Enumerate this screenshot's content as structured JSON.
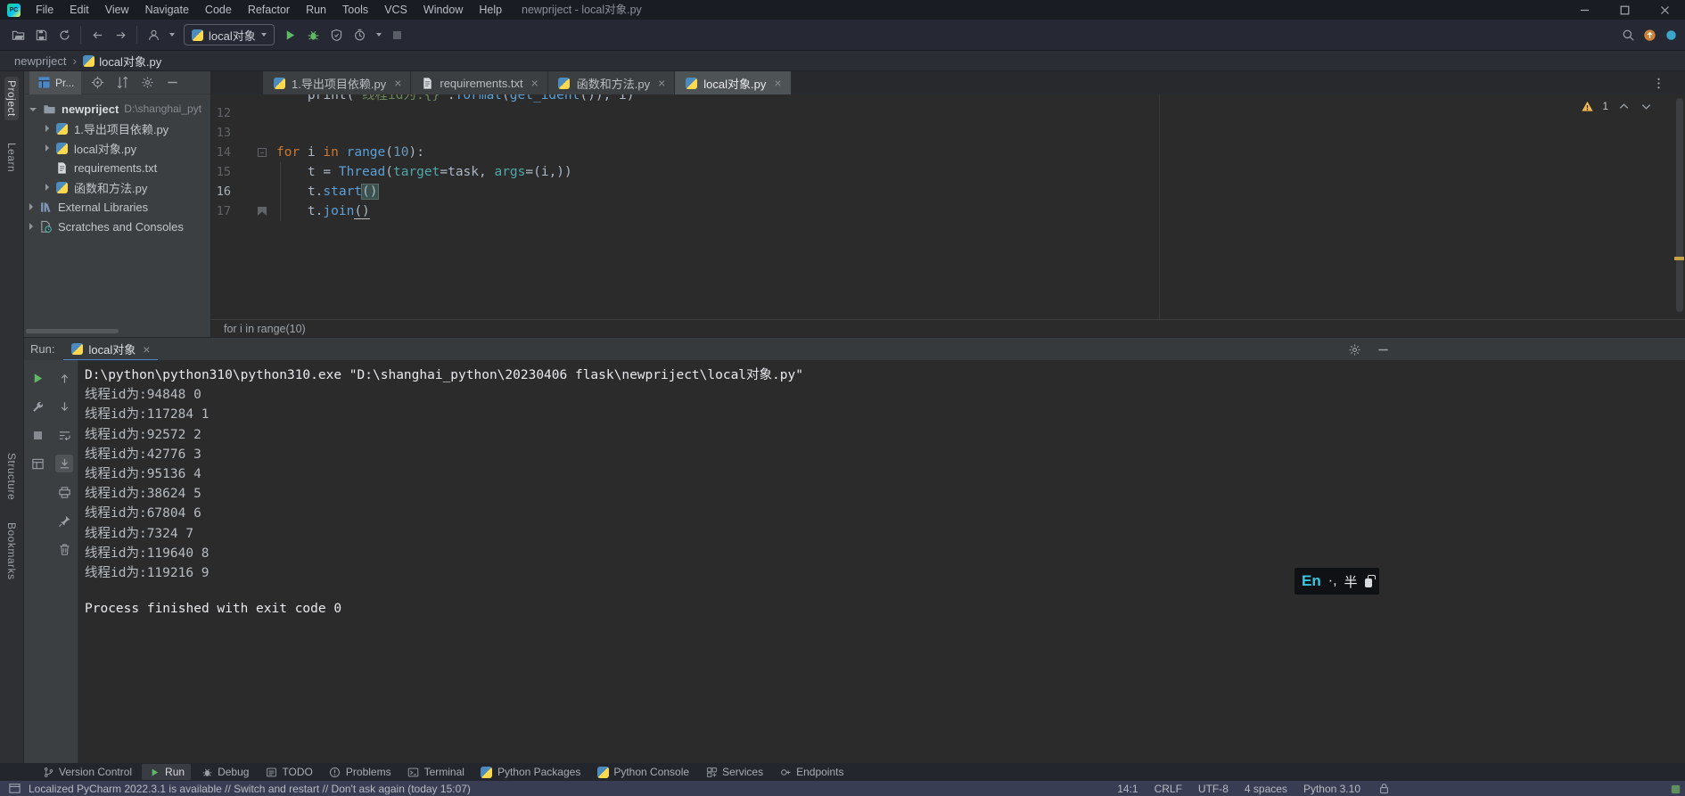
{
  "window": {
    "title": "newpriject - local对象.py"
  },
  "menubar": [
    "File",
    "Edit",
    "View",
    "Navigate",
    "Code",
    "Refactor",
    "Run",
    "Tools",
    "VCS",
    "Window",
    "Help"
  ],
  "toolbar": {
    "run_config_label": "local对象"
  },
  "breadcrumb_bar": [
    "newpriject",
    "local对象.py"
  ],
  "left_stripe": {
    "top": [
      "Project",
      "Learn"
    ],
    "bottom": [
      "Structure",
      "Bookmarks"
    ]
  },
  "project_panel": {
    "tab_label": "Pr...",
    "tree": [
      {
        "depth": 0,
        "chevron": "down",
        "icon": "folder",
        "label": "newpriject",
        "bold": true,
        "path": "D:\\shanghai_pyt"
      },
      {
        "depth": 1,
        "chevron": "right",
        "icon": "python",
        "label": "1.导出项目依赖.py"
      },
      {
        "depth": 1,
        "chevron": "right",
        "icon": "python",
        "label": "local对象.py"
      },
      {
        "depth": 1,
        "chevron": "none",
        "icon": "textfile",
        "label": "requirements.txt"
      },
      {
        "depth": 1,
        "chevron": "right",
        "icon": "python",
        "label": "函数和方法.py"
      },
      {
        "depth": 0,
        "chevron": "right",
        "icon": "libraries",
        "label": "External Libraries"
      },
      {
        "depth": 0,
        "chevron": "right",
        "icon": "scratches",
        "label": "Scratches and Consoles"
      }
    ]
  },
  "editor_tabs": [
    {
      "icon": "python",
      "label": "1.导出项目依赖.py",
      "active": false
    },
    {
      "icon": "textfile",
      "label": "requirements.txt",
      "active": false
    },
    {
      "icon": "python",
      "label": "函数和方法.py",
      "active": false
    },
    {
      "icon": "python",
      "label": "local对象.py",
      "active": true
    }
  ],
  "editor": {
    "warning_count": "1",
    "breadcrumb": "for i in range(10)",
    "clipped_line": [
      {
        "t": "    print(",
        "c": "p"
      },
      {
        "t": "\"线程id为:{}\"",
        "c": "s"
      },
      {
        "t": ".",
        "c": "p"
      },
      {
        "t": "format",
        "c": "f"
      },
      {
        "t": "(",
        "c": "p"
      },
      {
        "t": "get_ident",
        "c": "f"
      },
      {
        "t": "()), i)",
        "c": "p"
      }
    ],
    "lines": [
      {
        "num": "12",
        "tokens": []
      },
      {
        "num": "13",
        "tokens": []
      },
      {
        "num": "14",
        "fold": "start",
        "tokens": [
          {
            "t": "for",
            "c": "k"
          },
          {
            "t": " i ",
            "c": "p"
          },
          {
            "t": "in",
            "c": "k"
          },
          {
            "t": " ",
            "c": "p"
          },
          {
            "t": "range",
            "c": "f"
          },
          {
            "t": "(",
            "c": "p"
          },
          {
            "t": "10",
            "c": "n"
          },
          {
            "t": "):",
            "c": "p"
          }
        ]
      },
      {
        "num": "15",
        "tokens": [
          {
            "t": "    t = ",
            "c": "p"
          },
          {
            "t": "Thread",
            "c": "f"
          },
          {
            "t": "(",
            "c": "p"
          },
          {
            "t": "target",
            "c": "a"
          },
          {
            "t": "=task, ",
            "c": "p"
          },
          {
            "t": "args",
            "c": "a"
          },
          {
            "t": "=(i,))",
            "c": "p"
          }
        ]
      },
      {
        "num": "16",
        "current": true,
        "tokens": [
          {
            "t": "    t.",
            "c": "p"
          },
          {
            "t": "start",
            "c": "f"
          },
          {
            "t": "()",
            "c": "b"
          }
        ]
      },
      {
        "num": "17",
        "fold": "end",
        "tokens": [
          {
            "t": "    t.",
            "c": "p"
          },
          {
            "t": "join",
            "c": "f"
          },
          {
            "t": "()",
            "c": "u"
          }
        ]
      }
    ]
  },
  "run_panel": {
    "label": "Run:",
    "tab_label": "local对象",
    "toolbar_col1": [
      "rerun",
      "wrench",
      "stop",
      "layout"
    ],
    "toolbar_col2": [
      "up",
      "down",
      "softwrap",
      "scrollend",
      "print",
      "pin",
      "trash"
    ],
    "toolbar_selected": "scrollend",
    "console": [
      {
        "text": "D:\\python\\python310\\python310.exe \"D:\\shanghai_python\\20230406 flask\\newpriject\\local对象.py\"",
        "kind": "cmd"
      },
      {
        "text": "线程id为:94848 0",
        "kind": "out"
      },
      {
        "text": "线程id为:117284 1",
        "kind": "out"
      },
      {
        "text": "线程id为:92572 2",
        "kind": "out"
      },
      {
        "text": "线程id为:42776 3",
        "kind": "out"
      },
      {
        "text": "线程id为:95136 4",
        "kind": "out"
      },
      {
        "text": "线程id为:38624 5",
        "kind": "out"
      },
      {
        "text": "线程id为:67804 6",
        "kind": "out"
      },
      {
        "text": "线程id为:7324 7",
        "kind": "out"
      },
      {
        "text": "线程id为:119640 8",
        "kind": "out"
      },
      {
        "text": "线程id为:119216 9",
        "kind": "out"
      },
      {
        "text": "",
        "kind": "out"
      },
      {
        "text": "Process finished with exit code 0",
        "kind": "cmd"
      }
    ]
  },
  "toolwindow_bar": [
    {
      "icon": "vcs",
      "label": "Version Control",
      "active": false
    },
    {
      "icon": "run",
      "label": "Run",
      "active": true
    },
    {
      "icon": "debug",
      "label": "Debug",
      "active": false
    },
    {
      "icon": "todo",
      "label": "TODO",
      "active": false
    },
    {
      "icon": "problems",
      "label": "Problems",
      "active": false
    },
    {
      "icon": "terminal",
      "label": "Terminal",
      "active": false
    },
    {
      "icon": "python",
      "label": "Python Packages",
      "active": false
    },
    {
      "icon": "python",
      "label": "Python Console",
      "active": false
    },
    {
      "icon": "services",
      "label": "Services",
      "active": false
    },
    {
      "icon": "endpoints",
      "label": "Endpoints",
      "active": false
    }
  ],
  "status_bar": {
    "message_parts": [
      {
        "t": "Localized PyCharm 2022.3.1 is available // ",
        "link": false
      },
      {
        "t": "Switch and restart",
        "link": true
      },
      {
        "t": " // ",
        "link": false
      },
      {
        "t": "Don't ask again (today 15:07)",
        "link": true
      }
    ],
    "right_items": [
      "14:1",
      "CRLF",
      "UTF-8",
      "4 spaces",
      "Python 3.10"
    ]
  },
  "ime": {
    "lang": "En",
    "punct": "·,",
    "width": "半"
  }
}
